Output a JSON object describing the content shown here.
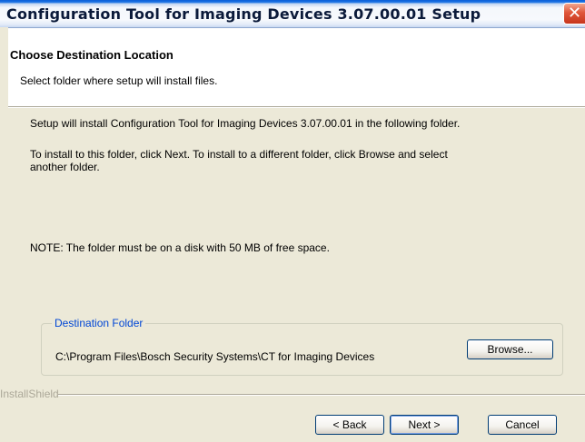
{
  "window": {
    "title": "Configuration Tool for Imaging Devices 3.07.00.01 Setup",
    "close_symbol": "✕"
  },
  "header": {
    "title": "Choose Destination Location",
    "subtitle": "Select folder where setup will install files."
  },
  "body": {
    "line1": "Setup will install Configuration Tool for Imaging Devices 3.07.00.01 in the following folder.",
    "line2a": "To install to this folder, click Next.  To install to a different folder, click Browse and select",
    "line2b": "another folder.",
    "note": "NOTE:  The folder must be on a disk with 50 MB of free space."
  },
  "destination": {
    "group_label": "Destination Folder",
    "path": "C:\\Program Files\\Bosch Security Systems\\CT for Imaging Devices",
    "browse_label": "Browse..."
  },
  "footer": {
    "brand": "InstallShield",
    "back_label": "< Back",
    "next_label": "Next >",
    "cancel_label": "Cancel"
  }
}
